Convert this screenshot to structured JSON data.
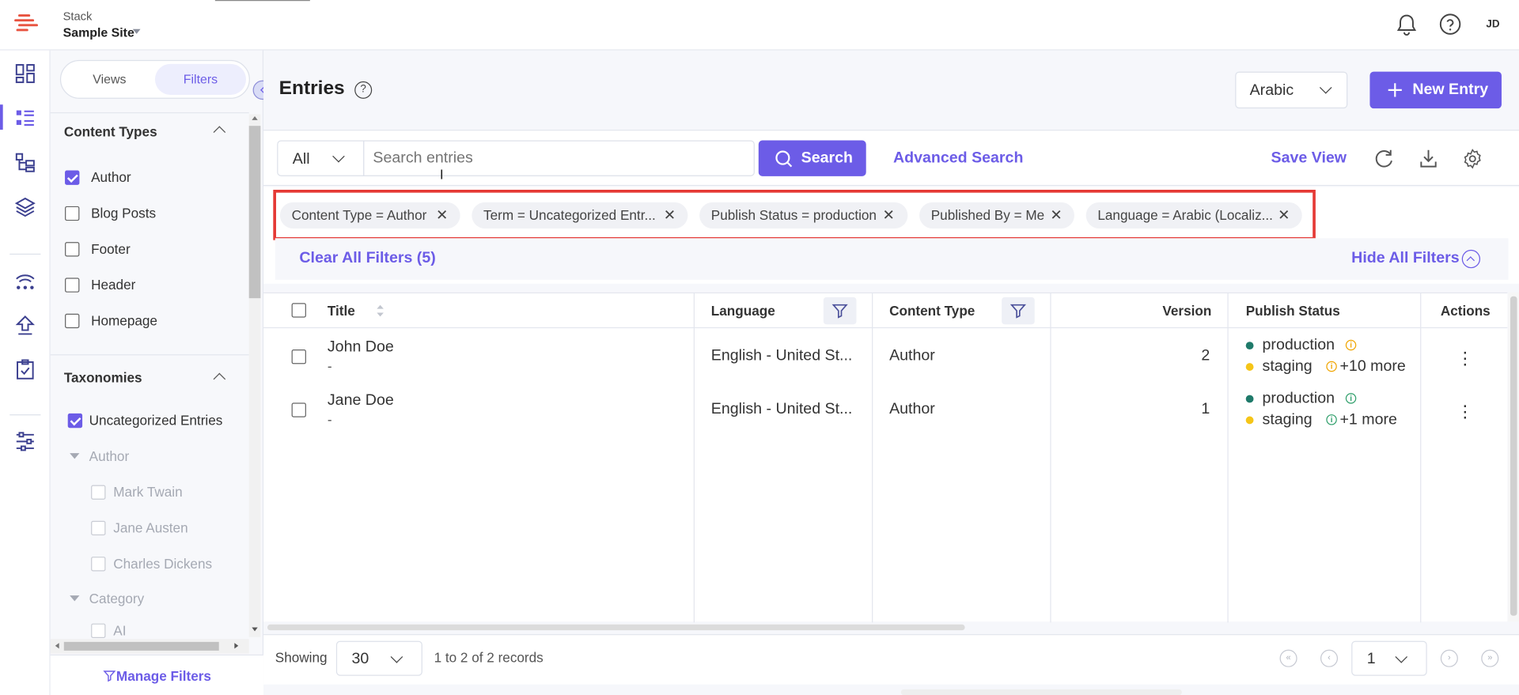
{
  "header": {
    "stack_label": "Stack",
    "site_name": "Sample Site",
    "avatar_initials": "JD"
  },
  "sidebar": {
    "tabs": {
      "views": "Views",
      "filters": "Filters"
    },
    "content_types": {
      "heading": "Content Types",
      "items": [
        {
          "label": "Author",
          "checked": true
        },
        {
          "label": "Blog Posts",
          "checked": false
        },
        {
          "label": "Footer",
          "checked": false
        },
        {
          "label": "Header",
          "checked": false
        },
        {
          "label": "Homepage",
          "checked": false
        }
      ]
    },
    "taxonomies": {
      "heading": "Taxonomies",
      "uncategorized": "Uncategorized Entries",
      "group_author": "Author",
      "authors": [
        "Mark Twain",
        "Jane Austen",
        "Charles Dickens"
      ],
      "group_category": "Category",
      "categories": [
        "AI"
      ]
    },
    "manage_filters": "Manage Filters"
  },
  "main": {
    "title": "Entries",
    "language_select": "Arabic",
    "new_entry": "New Entry",
    "search": {
      "scope": "All",
      "placeholder": "Search entries",
      "button": "Search",
      "advanced": "Advanced Search",
      "save_view": "Save View"
    },
    "filters": [
      "Content Type = Author",
      "Term = Uncategorized Entr...",
      "Publish Status = production",
      "Published By = Me",
      "Language = Arabic (Localiz..."
    ],
    "clear_all": "Clear All Filters (5)",
    "hide_all": "Hide All Filters"
  },
  "table": {
    "columns": {
      "title": "Title",
      "language": "Language",
      "content_type": "Content Type",
      "version": "Version",
      "publish_status": "Publish Status",
      "actions": "Actions"
    },
    "rows": [
      {
        "title": "John Doe",
        "subtitle": "-",
        "language": "English - United St...",
        "content_type": "Author",
        "version": "2",
        "status_1": "production",
        "status_2": "staging",
        "more": "+10 more"
      },
      {
        "title": "Jane Doe",
        "subtitle": "-",
        "language": "English - United St...",
        "content_type": "Author",
        "version": "1",
        "status_1": "production",
        "status_2": "staging",
        "more": "+1 more"
      }
    ]
  },
  "footer": {
    "showing": "Showing",
    "per_page": "30",
    "records": "1 to 2 of 2 records",
    "page": "1"
  },
  "colors": {
    "accent": "#6c5ce7",
    "highlight_border": "#e53935",
    "production_dot": "#1f7a6a",
    "staging_dot": "#f5c518",
    "warn_info": "#f0a500",
    "ok_info": "#2e9e6a"
  }
}
